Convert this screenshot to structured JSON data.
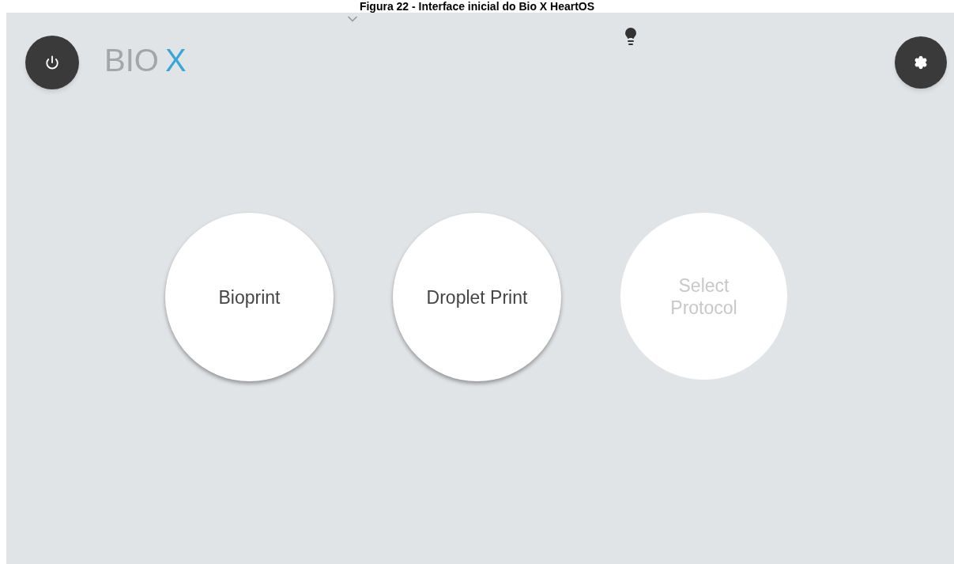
{
  "caption": "Figura 22 - Interface inicial do Bio X HeartOS",
  "logo": {
    "text": "BIO",
    "accent": "X"
  },
  "actions": [
    {
      "label": "Bioprint",
      "disabled": false
    },
    {
      "label": "Droplet Print",
      "disabled": false
    },
    {
      "label": "Select Protocol",
      "disabled": true
    }
  ]
}
